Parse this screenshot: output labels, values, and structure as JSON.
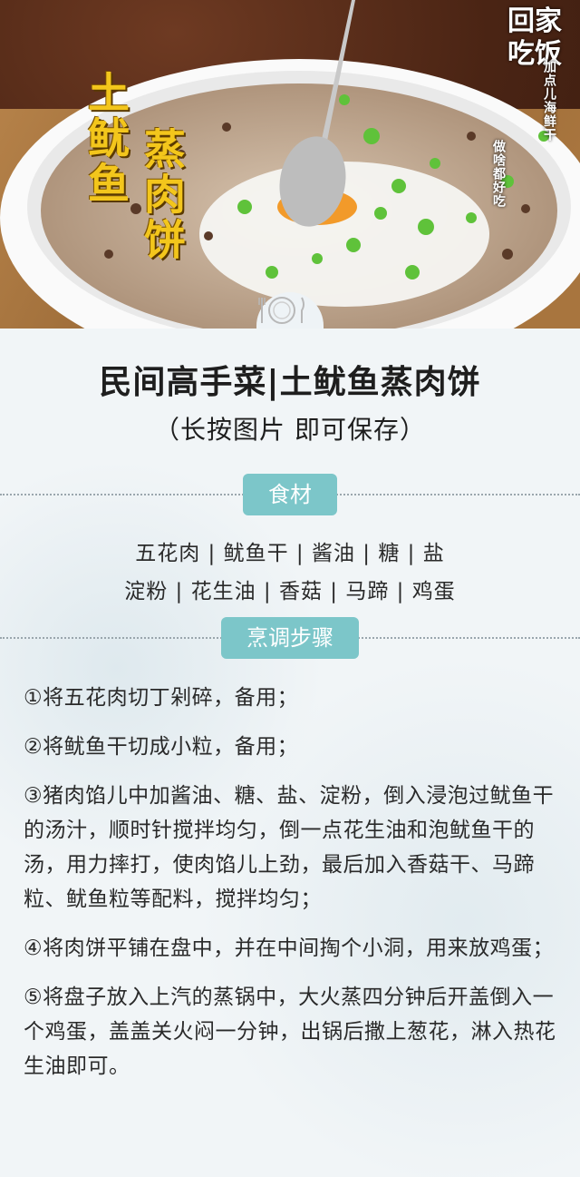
{
  "hero": {
    "title_line1": "土鱿鱼",
    "title_line2": "蒸肉饼",
    "brand_logo": "回家吃饭",
    "brand_slogan1": "加点儿海鲜干",
    "brand_slogan2": "做啥都好吃"
  },
  "header": {
    "title": "民间高手菜|土鱿鱼蒸肉饼",
    "subtitle": "（长按图片  即可保存）"
  },
  "ingredients": {
    "heading": "食材",
    "line1": "五花肉 | 鱿鱼干 | 酱油 | 糖 | 盐",
    "line2": "淀粉 | 花生油 | 香菇 | 马蹄 | 鸡蛋"
  },
  "steps": {
    "heading": "烹调步骤",
    "items": [
      "①将五花肉切丁剁碎，备用；",
      "②将鱿鱼干切成小粒，备用；",
      "③猪肉馅儿中加酱油、糖、盐、淀粉，倒入浸泡过鱿鱼干的汤汁，顺时针搅拌均匀，倒一点花生油和泡鱿鱼干的汤，用力摔打，使肉馅儿上劲，最后加入香菇干、马蹄粒、鱿鱼粒等配料，搅拌均匀；",
      "④将肉饼平铺在盘中，并在中间掏个小洞，用来放鸡蛋；",
      "⑤将盘子放入上汽的蒸锅中，大火蒸四分钟后开盖倒入一个鸡蛋，盖盖关火闷一分钟，出锅后撒上葱花，淋入热花生油即可。"
    ]
  },
  "colors": {
    "accent_pill": "#7cc6c9",
    "title_gold": "#f3c61c"
  }
}
